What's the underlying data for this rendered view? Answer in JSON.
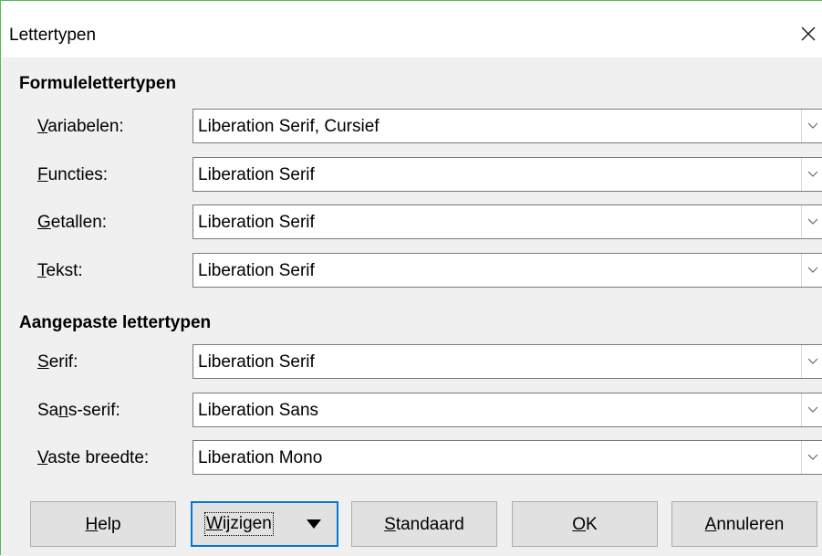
{
  "dialog": {
    "title": "Lettertypen",
    "close_symbol": "×"
  },
  "formula_fonts": {
    "heading": "Formulelettertypen",
    "rows": [
      {
        "label_key": "V",
        "label_rest": "ariabelen:",
        "value": "Liberation Serif, Cursief"
      },
      {
        "label_key": "F",
        "label_rest": "uncties:",
        "value": "Liberation Serif"
      },
      {
        "label_key": "G",
        "label_rest": "etallen:",
        "value": "Liberation Serif"
      },
      {
        "label_key": "T",
        "label_rest": "ekst:",
        "value": "Liberation Serif"
      }
    ]
  },
  "custom_fonts": {
    "heading": "Aangepaste lettertypen",
    "rows": [
      {
        "label_key": "S",
        "label_rest": "erif:",
        "value": "Liberation Serif"
      },
      {
        "label_pre": "Sa",
        "label_key": "n",
        "label_rest": "s-serif:",
        "value": "Liberation Sans"
      },
      {
        "label_key": "V",
        "label_rest": "aste breedte:",
        "value": "Liberation Mono"
      }
    ]
  },
  "buttons": {
    "help": {
      "key": "H",
      "rest": "elp"
    },
    "modify": {
      "key": "W",
      "rest": "ijzigen"
    },
    "default": {
      "key": "S",
      "rest": "tandaard"
    },
    "ok": {
      "key": "O",
      "rest": "K"
    },
    "cancel": {
      "key": "A",
      "rest": "nnuleren"
    }
  },
  "icons": {
    "close": "close-icon",
    "dropdown": "chevron-down-icon",
    "menu_arrow": "triangle-down-icon"
  },
  "colors": {
    "window_border": "#5cb85c",
    "focus_border": "#0078d7",
    "button_face": "#e1e1e1",
    "content_bg": "#f0f0f0"
  }
}
